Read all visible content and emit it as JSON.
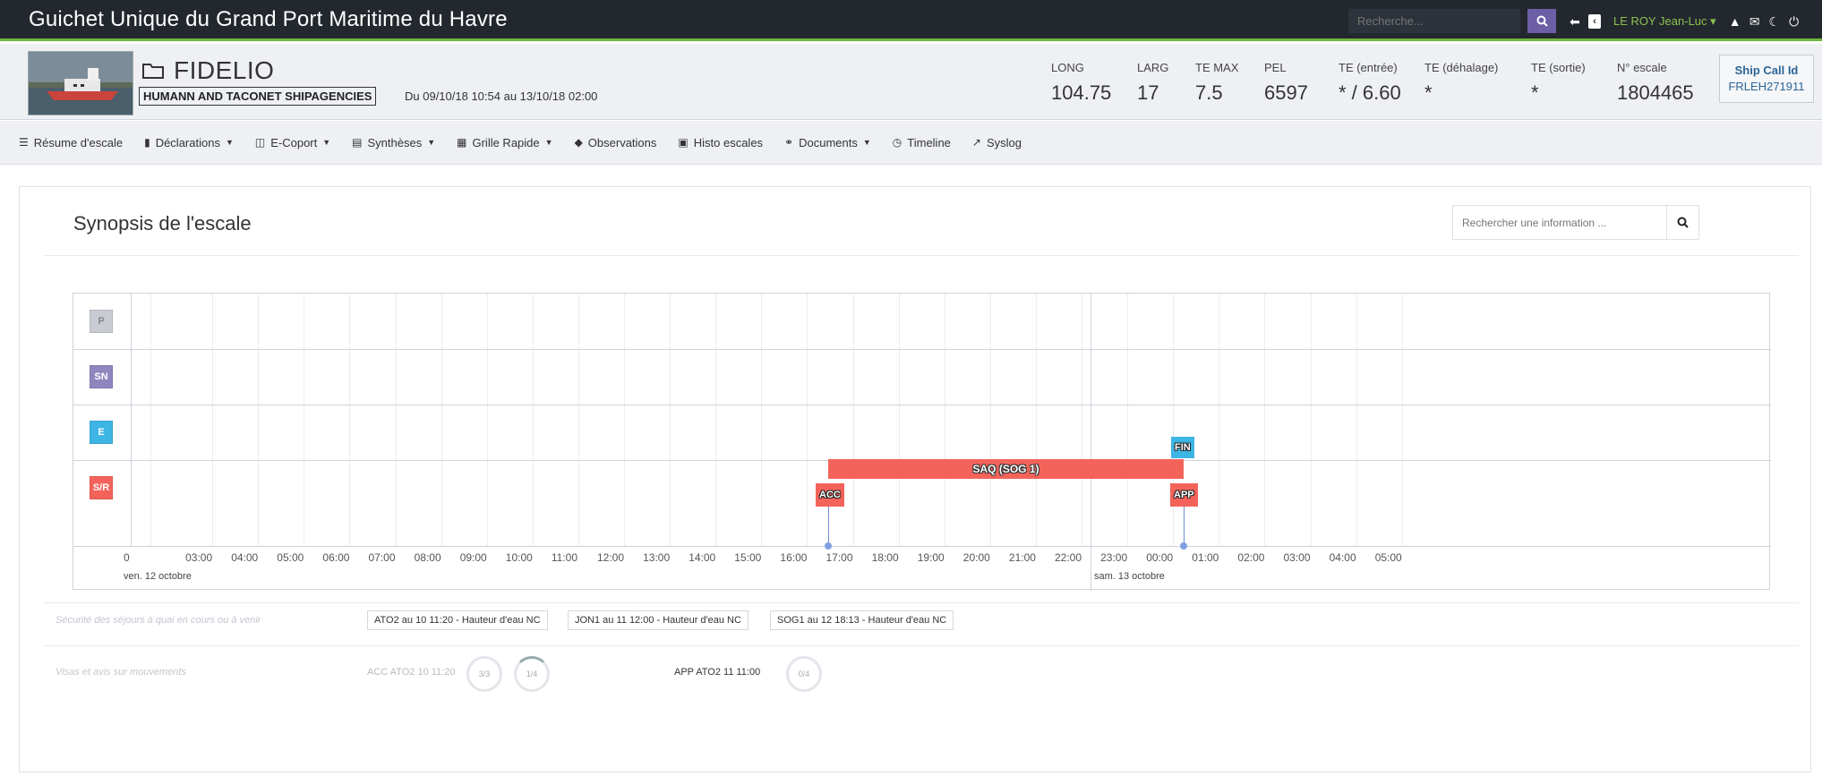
{
  "topbar": {
    "title": "Guichet Unique du Grand Port Maritime du Havre",
    "search_placeholder": "Recherche...",
    "user": "LE ROY Jean-Luc"
  },
  "vessel": {
    "name": "FIDELIO",
    "agency": "HUMANN AND TACONET SHIPAGENCIES",
    "period": "Du 09/10/18 10:54 au 13/10/18 02:00",
    "stats": [
      {
        "label": "LONG",
        "value": "104.75"
      },
      {
        "label": "LARG",
        "value": "17"
      },
      {
        "label": "TE MAX",
        "value": "7.5"
      },
      {
        "label": "PEL",
        "value": "6597"
      },
      {
        "label": "TE (entrée)",
        "value": "* / 6.60"
      },
      {
        "label": "TE (déhalage)",
        "value": "*"
      },
      {
        "label": "TE (sortie)",
        "value": "*"
      },
      {
        "label": "N° escale",
        "value": "1804465"
      }
    ],
    "ship_call_label": "Ship Call Id",
    "ship_call_value": "FRLEH271911"
  },
  "menu": [
    {
      "label": "Résume d'escale",
      "icon": "list-icon",
      "dropdown": false
    },
    {
      "label": "Déclarations",
      "icon": "clipboard-icon",
      "dropdown": true
    },
    {
      "label": "E-Coport",
      "icon": "building-icon",
      "dropdown": true
    },
    {
      "label": "Synthèses",
      "icon": "table-icon",
      "dropdown": true
    },
    {
      "label": "Grille Rapide",
      "icon": "grid-icon",
      "dropdown": true
    },
    {
      "label": "Observations",
      "icon": "tag-icon",
      "dropdown": false
    },
    {
      "label": "Histo escales",
      "icon": "archive-icon",
      "dropdown": false
    },
    {
      "label": "Documents",
      "icon": "link-icon",
      "dropdown": true
    },
    {
      "label": "Timeline",
      "icon": "clock-icon",
      "dropdown": false
    },
    {
      "label": "Syslog",
      "icon": "external-icon",
      "dropdown": false
    }
  ],
  "synopsis": {
    "title": "Synopsis de l'escale",
    "search_placeholder": "Rechercher une information ..."
  },
  "timeline": {
    "rows": [
      {
        "code": "P",
        "color": "#c8cbd1"
      },
      {
        "code": "SN",
        "color": "#8f86c0"
      },
      {
        "code": "E",
        "color": "#3db5e5"
      },
      {
        "code": "S/R",
        "color": "#f4635a"
      }
    ],
    "ticks": [
      "0",
      "03:00",
      "04:00",
      "05:00",
      "06:00",
      "07:00",
      "08:00",
      "09:00",
      "10:00",
      "11:00",
      "12:00",
      "13:00",
      "14:00",
      "15:00",
      "16:00",
      "17:00",
      "18:00",
      "19:00",
      "20:00",
      "21:00",
      "22:00",
      "23:00",
      "00:00",
      "01:00",
      "02:00",
      "03:00",
      "04:00",
      "05:00"
    ],
    "day1": "ven. 12 octobre",
    "day2": "sam. 13 octobre",
    "bar_label": "SAQ (SOG 1)",
    "markers": {
      "acc": "ACC",
      "app": "APP",
      "fin": "FIN"
    },
    "colors": {
      "bar": "#f4635a",
      "fin": "#3db5e5"
    }
  },
  "securite": {
    "label": "Sécurité des séjours à quai en cours ou à venir",
    "items": [
      "ATO2 au 10 11:20 - Hauteur d'eau NC",
      "JON1 au 11 12:00 - Hauteur d'eau NC",
      "SOG1 au 12 18:13 - Hauteur d'eau NC"
    ]
  },
  "visas": {
    "label": "Visas et avis sur mouvements",
    "acc_label": "ACC ATO2 10 11:20",
    "acc_ring1": "3/3",
    "acc_ring2": "1/4",
    "app_label": "APP ATO2 11 11:00",
    "app_ring": "0/4"
  }
}
